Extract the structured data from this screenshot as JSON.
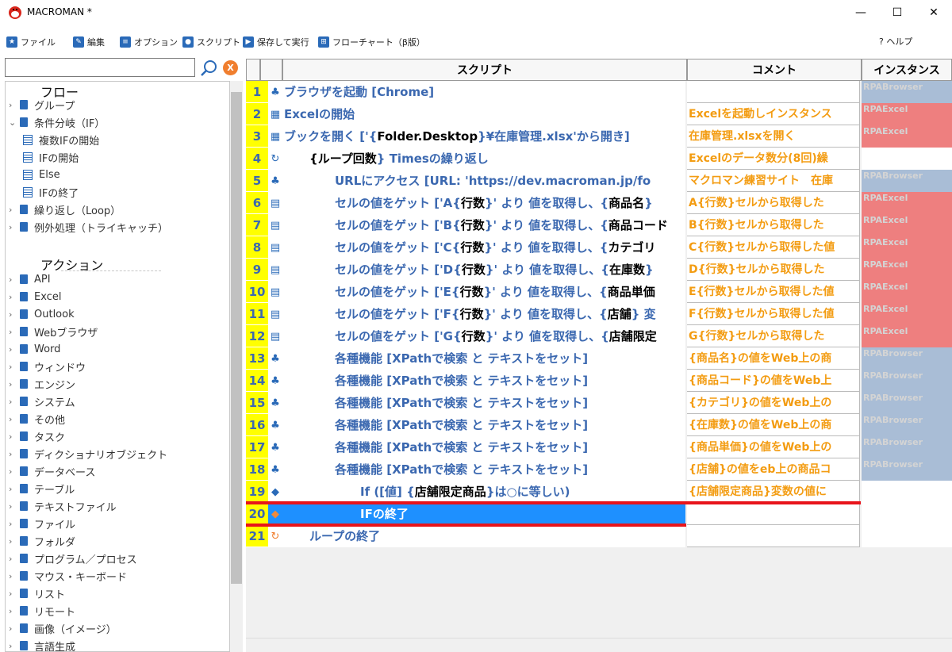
{
  "window": {
    "title": "MACROMAN *",
    "minimize": "—",
    "maximize": "☐",
    "close": "✕"
  },
  "menu": {
    "items": [
      {
        "label": "ファイル",
        "icon": "★"
      },
      {
        "label": "編集",
        "icon": "✎"
      },
      {
        "label": "オプション",
        "icon": "≡"
      },
      {
        "label": "スクリプト",
        "icon": "●"
      },
      {
        "label": "保存して実行",
        "icon": "▶"
      },
      {
        "label": "フローチャート（β版）",
        "icon": "⊞"
      }
    ],
    "help": "? ヘルプ"
  },
  "left": {
    "search_value": "",
    "clear_label": "X",
    "flow_title": "フロー",
    "flow_items": [
      {
        "label": "グループ",
        "chev": "›",
        "icon": "book",
        "indent": 0
      },
      {
        "label": "条件分岐（IF）",
        "chev": "⌄",
        "icon": "book",
        "indent": 0
      },
      {
        "label": "複数IFの開始",
        "chev": "",
        "icon": "list",
        "indent": 1
      },
      {
        "label": "IFの開始",
        "chev": "",
        "icon": "list",
        "indent": 1
      },
      {
        "label": "Else",
        "chev": "",
        "icon": "list",
        "indent": 1
      },
      {
        "label": "IFの終了",
        "chev": "",
        "icon": "list",
        "indent": 1
      },
      {
        "label": "繰り返し（Loop）",
        "chev": "›",
        "icon": "book",
        "indent": 0
      },
      {
        "label": "例外処理（トライキャッチ）",
        "chev": "›",
        "icon": "book",
        "indent": 0
      }
    ],
    "action_title": "アクション",
    "action_items": [
      "API",
      "Excel",
      "Outlook",
      "Webブラウザ",
      "Word",
      "ウィンドウ",
      "エンジン",
      "システム",
      "その他",
      "タスク",
      "ディクショナリオブジェクト",
      "データベース",
      "テーブル",
      "テキストファイル",
      "ファイル",
      "フォルダ",
      "プログラム／プロセス",
      "マウス・キーボード",
      "リスト",
      "リモート",
      "画像（イメージ）",
      "言語生成"
    ]
  },
  "grid": {
    "headers": {
      "script": "スクリプト",
      "comment": "コメント",
      "instance": "インスタンス"
    },
    "colors": {
      "browser": "#a9bdd6",
      "excel": "#ee7f7f",
      "yellow": "#ffff00",
      "orange": "#f39c12",
      "blue": "#3b68b0",
      "select": "#1e90ff"
    },
    "rows": [
      {
        "n": "1",
        "icon": "♣",
        "indent": 0,
        "parts": [
          [
            "ブラウザを起動 [Chrome]",
            ""
          ]
        ],
        "comment": "",
        "instance": "RPABrowser",
        "itype": "browser"
      },
      {
        "n": "2",
        "icon": "▦",
        "indent": 0,
        "parts": [
          [
            "Excelの開始",
            ""
          ]
        ],
        "comment": "Excelを起動しインスタンス",
        "instance": "RPAExcel",
        "itype": "excel"
      },
      {
        "n": "3",
        "icon": "▦",
        "indent": 0,
        "parts": [
          [
            "ブックを開く ['{",
            ""
          ],
          [
            "Folder.Desktop",
            "dk"
          ],
          [
            "}¥在庫管理.xlsx'から開き]",
            ""
          ]
        ],
        "comment": "在庫管理.xlsxを開く",
        "instance": "RPAExcel",
        "itype": "excel"
      },
      {
        "n": "4",
        "icon": "↻",
        "indent": 1,
        "parts": [
          [
            "{",
            "dk"
          ],
          [
            "ループ回数",
            "dk"
          ],
          [
            "} Timesの繰り返し",
            ""
          ]
        ],
        "comment": "Excelのデータ数分(8回)繰",
        "instance": "",
        "itype": ""
      },
      {
        "n": "5",
        "icon": "♣",
        "indent": 2,
        "parts": [
          [
            "URLにアクセス [URL: 'https://dev.macroman.jp/fo",
            ""
          ]
        ],
        "comment": "マクロマン練習サイト　在庫",
        "instance": "RPABrowser",
        "itype": "browser"
      },
      {
        "n": "6",
        "icon": "▤",
        "indent": 2,
        "parts": [
          [
            "セルの値をゲット ['A{",
            ""
          ],
          [
            "行数",
            "dk"
          ],
          [
            "}' より 値を取得し、{",
            ""
          ],
          [
            "商品名",
            "dk"
          ],
          [
            "}",
            ""
          ]
        ],
        "comment": "A{行数}セルから取得した",
        "instance": "RPAExcel",
        "itype": "excel"
      },
      {
        "n": "7",
        "icon": "▤",
        "indent": 2,
        "parts": [
          [
            "セルの値をゲット ['B{",
            ""
          ],
          [
            "行数",
            "dk"
          ],
          [
            "}' より 値を取得し、{",
            ""
          ],
          [
            "商品コード",
            "dk"
          ]
        ],
        "comment": "B{行数}セルから取得した",
        "instance": "RPAExcel",
        "itype": "excel"
      },
      {
        "n": "8",
        "icon": "▤",
        "indent": 2,
        "parts": [
          [
            "セルの値をゲット ['C{",
            ""
          ],
          [
            "行数",
            "dk"
          ],
          [
            "}' より 値を取得し、{",
            ""
          ],
          [
            "カテゴリ",
            "dk"
          ]
        ],
        "comment": "C{行数}セルから取得した値",
        "instance": "RPAExcel",
        "itype": "excel"
      },
      {
        "n": "9",
        "icon": "▤",
        "indent": 2,
        "parts": [
          [
            "セルの値をゲット ['D{",
            ""
          ],
          [
            "行数",
            "dk"
          ],
          [
            "}' より 値を取得し、{",
            ""
          ],
          [
            "在庫数",
            "dk"
          ],
          [
            "}",
            ""
          ]
        ],
        "comment": "D{行数}セルから取得した",
        "instance": "RPAExcel",
        "itype": "excel"
      },
      {
        "n": "10",
        "icon": "▤",
        "indent": 2,
        "parts": [
          [
            "セルの値をゲット ['E{",
            ""
          ],
          [
            "行数",
            "dk"
          ],
          [
            "}' より 値を取得し、{",
            ""
          ],
          [
            "商品単価",
            "dk"
          ]
        ],
        "comment": "E{行数}セルから取得した値",
        "instance": "RPAExcel",
        "itype": "excel"
      },
      {
        "n": "11",
        "icon": "▤",
        "indent": 2,
        "parts": [
          [
            "セルの値をゲット ['F{",
            ""
          ],
          [
            "行数",
            "dk"
          ],
          [
            "}' より 値を取得し、{",
            ""
          ],
          [
            "店舗",
            "dk"
          ],
          [
            "} 変",
            ""
          ]
        ],
        "comment": "F{行数}セルから取得した値",
        "instance": "RPAExcel",
        "itype": "excel"
      },
      {
        "n": "12",
        "icon": "▤",
        "indent": 2,
        "parts": [
          [
            "セルの値をゲット ['G{",
            ""
          ],
          [
            "行数",
            "dk"
          ],
          [
            "}' より 値を取得し、{",
            ""
          ],
          [
            "店舗限定",
            "dk"
          ]
        ],
        "comment": "G{行数}セルから取得した",
        "instance": "RPAExcel",
        "itype": "excel"
      },
      {
        "n": "13",
        "icon": "♣",
        "indent": 2,
        "parts": [
          [
            "各種機能 [XPathで検索 と テキストをセット]",
            ""
          ]
        ],
        "comment": "{商品名}の値をWeb上の商",
        "instance": "RPABrowser",
        "itype": "browser"
      },
      {
        "n": "14",
        "icon": "♣",
        "indent": 2,
        "parts": [
          [
            "各種機能 [XPathで検索 と テキストをセット]",
            ""
          ]
        ],
        "comment": "{商品コード}の値をWeb上",
        "instance": "RPABrowser",
        "itype": "browser"
      },
      {
        "n": "15",
        "icon": "♣",
        "indent": 2,
        "parts": [
          [
            "各種機能 [XPathで検索 と テキストをセット]",
            ""
          ]
        ],
        "comment": "{カテゴリ}の値をWeb上の",
        "instance": "RPABrowser",
        "itype": "browser"
      },
      {
        "n": "16",
        "icon": "♣",
        "indent": 2,
        "parts": [
          [
            "各種機能 [XPathで検索 と テキストをセット]",
            ""
          ]
        ],
        "comment": "{在庫数}の値をWeb上の商",
        "instance": "RPABrowser",
        "itype": "browser"
      },
      {
        "n": "17",
        "icon": "♣",
        "indent": 2,
        "parts": [
          [
            "各種機能 [XPathで検索 と テキストをセット]",
            ""
          ]
        ],
        "comment": "{商品単価}の値をWeb上の",
        "instance": "RPABrowser",
        "itype": "browser"
      },
      {
        "n": "18",
        "icon": "♣",
        "indent": 2,
        "parts": [
          [
            "各種機能 [XPathで検索 と テキストをセット]",
            ""
          ]
        ],
        "comment": "{店舗}の値をeb上の商品コ",
        "instance": "RPABrowser",
        "itype": "browser"
      },
      {
        "n": "19",
        "icon": "◆",
        "indent": 3,
        "parts": [
          [
            "If ([値] {",
            ""
          ],
          [
            "店舗限定商品",
            "dk"
          ],
          [
            "}は○に等しい)",
            ""
          ]
        ],
        "comment": "{店舗限定商品}変数の値に",
        "instance": "",
        "itype": ""
      },
      {
        "n": "20",
        "icon": "◆",
        "indent": 3,
        "parts": [
          [
            "IFの終了",
            ""
          ]
        ],
        "comment": "",
        "instance": "",
        "itype": "",
        "selected": true
      },
      {
        "n": "21",
        "icon": "↻",
        "indent": 1,
        "parts": [
          [
            "ループの終了",
            ""
          ]
        ],
        "comment": "",
        "instance": "",
        "itype": ""
      }
    ]
  }
}
